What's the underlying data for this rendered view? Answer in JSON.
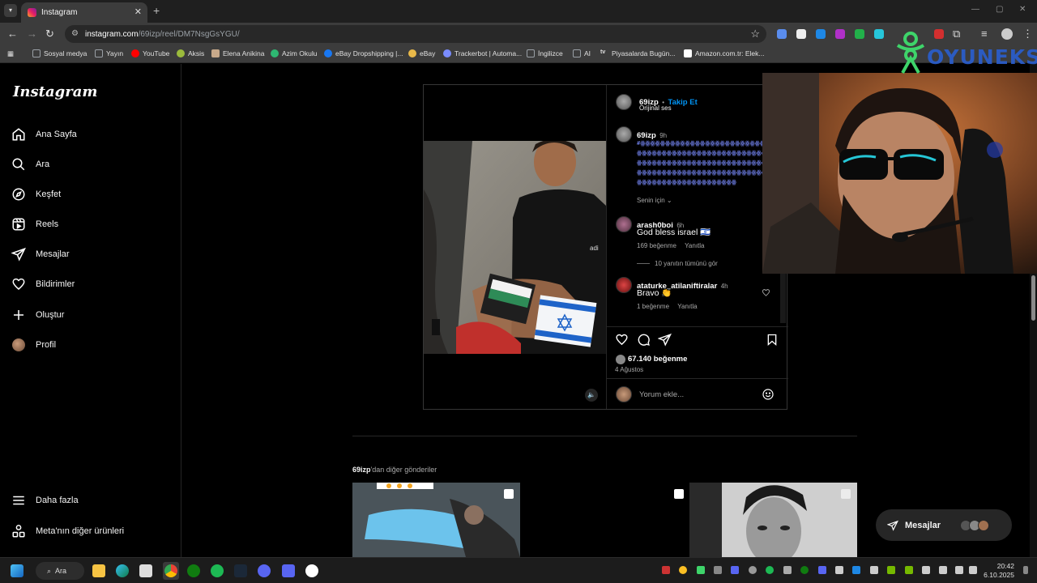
{
  "browser": {
    "tab_title": "Instagram",
    "url_host": "instagram.com",
    "url_path": "/69izp/reel/DM7NsgGsYGU/",
    "bookmarks": [
      {
        "label": "Sosyal medya",
        "icon": "folder-icon",
        "color": "#9aa0a6"
      },
      {
        "label": "Yayın",
        "icon": "folder-icon",
        "color": "#9aa0a6"
      },
      {
        "label": "YouTube",
        "icon": "youtube-icon",
        "color": "#ff0000"
      },
      {
        "label": "Aksis",
        "icon": "aksis-icon",
        "color": "#9bbb3c"
      },
      {
        "label": "Elena Anikina",
        "icon": "profile-icon",
        "color": "#c8a98a"
      },
      {
        "label": "Azim Okulu",
        "icon": "school-icon",
        "color": "#2eb872"
      },
      {
        "label": "eBay Dropshipping |...",
        "icon": "facebook-icon",
        "color": "#1877f2"
      },
      {
        "label": "eBay",
        "icon": "ebay-icon",
        "color": "#e9b949"
      },
      {
        "label": "Trackerbot | Automa...",
        "icon": "trackerbot-icon",
        "color": "#7a8cff"
      },
      {
        "label": "İngilizce",
        "icon": "folder-icon",
        "color": "#9aa0a6"
      },
      {
        "label": "AI",
        "icon": "folder-icon",
        "color": "#9aa0a6"
      },
      {
        "label": "Piyasalarda Bugün...",
        "icon": "tv-icon",
        "color": "#ffffff"
      },
      {
        "label": "Amazon.com.tr: Elek...",
        "icon": "amazon-icon",
        "color": "#ffffff"
      }
    ]
  },
  "sidebar": {
    "logo": "Instagram",
    "items": [
      {
        "label": "Ana Sayfa",
        "icon": "home-icon"
      },
      {
        "label": "Ara",
        "icon": "search-icon"
      },
      {
        "label": "Keşfet",
        "icon": "compass-icon"
      },
      {
        "label": "Reels",
        "icon": "reels-icon"
      },
      {
        "label": "Mesajlar",
        "icon": "messages-icon"
      },
      {
        "label": "Bildirimler",
        "icon": "heart-icon"
      },
      {
        "label": "Oluştur",
        "icon": "plus-icon"
      },
      {
        "label": "Profil",
        "icon": "profile-avatar"
      }
    ],
    "bottom": [
      {
        "label": "Daha fazla",
        "icon": "menu-icon"
      },
      {
        "label": "Meta'nın diğer ürünleri",
        "icon": "meta-products-icon"
      }
    ]
  },
  "post": {
    "author": "69izp",
    "separator": "•",
    "follow_label": "Takip Et",
    "audio": "Orijinal ses",
    "caption_user": "69izp",
    "caption_time": "9h",
    "caption_text": "#ꙮꙮꙮꙮꙮꙮꙮꙮꙮꙮꙮꙮꙮꙮꙮꙮꙮꙮꙮꙮꙮꙮꙮꙮꙮꙮꙮꙮꙮꙮꙮꙮꙮꙮꙮꙮꙮꙮꙮꙮꙮꙮꙮꙮꙮꙮꙮꙮꙮꙮꙮꙮꙮꙮꙮꙮꙮꙮꙮꙮꙮꙮꙮꙮꙮꙮꙮꙮꙮꙮꙮꙮꙮꙮꙮꙮꙮꙮꙮꙮꙮꙮꙮꙮꙮꙮꙮꙮꙮꙮꙮꙮꙮꙮꙮꙮꙮꙮꙮꙮꙮꙮꙮꙮꙮꙮꙮꙮꙮꙮꙮꙮꙮꙮꙮꙮꙮꙮꙮꙮꙮꙮꙮ",
    "for_you": "Senin için",
    "comments": [
      {
        "user": "arash0boi",
        "time": "6h",
        "text": "God bless israel 🇮🇱",
        "likes": "169 beğenme",
        "reply": "Yanıtla",
        "view_replies": "10 yanıtın tümünü gör"
      },
      {
        "user": "ataturke_atilaniftiralar",
        "time": "4h",
        "text": "Bravo 👏",
        "likes": "1 beğenme",
        "reply": "Yanıtla"
      }
    ],
    "like_count": "67.140 beğenme",
    "date": "4 Ağustos",
    "comment_placeholder": "Yorum ekle..."
  },
  "more_posts": {
    "user": "69izp",
    "suffix": "'dan diğer gönderiler"
  },
  "dm_pill": {
    "label": "Mesajlar"
  },
  "overlay": {
    "brand": "OYUNEKS"
  },
  "taskbar": {
    "search": "Ara",
    "time": "20:42",
    "date": "6.10.2025"
  }
}
